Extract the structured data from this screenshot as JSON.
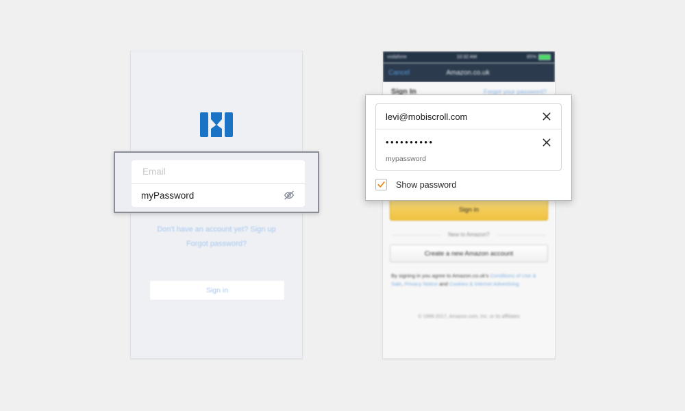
{
  "left_phone": {
    "logo_name": "mobiscroll-m-logo",
    "logo_color": "#1a73c4",
    "form": {
      "email_placeholder": "Email",
      "email_value": "",
      "password_value": "myPassword",
      "toggle_icon": "eye-slash-icon"
    },
    "links": [
      "Don't have an account yet? Sign up",
      "Forgot password?"
    ],
    "signin_label": "Sign in"
  },
  "right_phone": {
    "status_bar": {
      "carrier": "vodafone",
      "time": "10:32 AM",
      "battery": "85%"
    },
    "nav": {
      "cancel_label": "Cancel",
      "title": "Amazon.co.uk"
    },
    "page": {
      "signin_heading": "Sign In",
      "register_link": "Forgot your password?",
      "signin_button_label": "Sign in",
      "new_to_amazon_label": "New to Amazon?",
      "create_account_label": "Create a new Amazon account",
      "legal_prefix": "By signing in you agree to Amazon.co.uk's ",
      "legal_link_1": "Conditions of Use & Sale",
      "legal_sep_1": ", ",
      "legal_link_2": "Privacy Notice",
      "legal_sep_2": " and ",
      "legal_link_3": "Cookies & Internet Advertising",
      "copyright": "© 1996-2017, Amazon.com, Inc. or its affiliates"
    }
  },
  "autofill_dialog": {
    "email_value": "levi@mobiscroll.com",
    "password_masked": "••••••••••",
    "password_hint": "mypassword",
    "clear_icon": "close-icon",
    "show_password_label": "Show password",
    "show_password_checked": true,
    "checkmark_color": "#e8810c"
  }
}
